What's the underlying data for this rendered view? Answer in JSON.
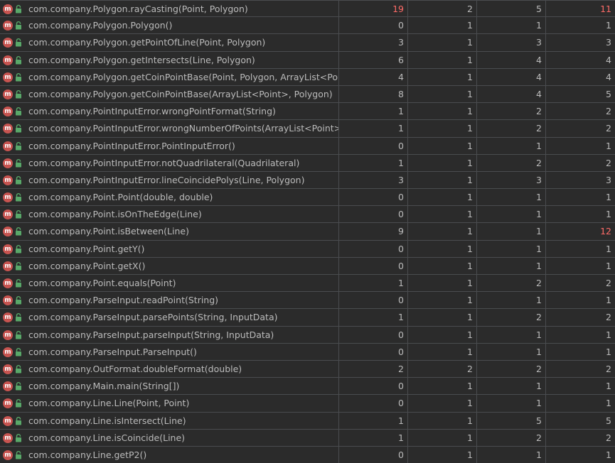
{
  "colors": {
    "background": "#2b2b2b",
    "grid": "#4a4c4f",
    "text": "#bbbbbb",
    "highlight": "#ff6b68",
    "method_icon": "#c75450",
    "access_icon": "#59a869"
  },
  "icons": {
    "method": "method-m-icon",
    "access": "public-lock-icon",
    "method_letter": "m"
  },
  "rows": [
    {
      "method": "com.company.Polygon.rayCasting(Point, Polygon)",
      "v1": "19",
      "v2": "2",
      "v3": "5",
      "v4": "11",
      "hot1": true,
      "hot4": true
    },
    {
      "method": "com.company.Polygon.Polygon()",
      "v1": "0",
      "v2": "1",
      "v3": "1",
      "v4": "1"
    },
    {
      "method": "com.company.Polygon.getPointOfLine(Point, Polygon)",
      "v1": "3",
      "v2": "1",
      "v3": "3",
      "v4": "3"
    },
    {
      "method": "com.company.Polygon.getIntersects(Line, Polygon)",
      "v1": "6",
      "v2": "1",
      "v3": "4",
      "v4": "4"
    },
    {
      "method": "com.company.Polygon.getCoinPointBase(Point, Polygon, ArrayList<Point>)",
      "v1": "4",
      "v2": "1",
      "v3": "4",
      "v4": "4"
    },
    {
      "method": "com.company.Polygon.getCoinPointBase(ArrayList<Point>, Polygon)",
      "v1": "8",
      "v2": "1",
      "v3": "4",
      "v4": "5"
    },
    {
      "method": "com.company.PointInputError.wrongPointFormat(String)",
      "v1": "1",
      "v2": "1",
      "v3": "2",
      "v4": "2"
    },
    {
      "method": "com.company.PointInputError.wrongNumberOfPoints(ArrayList<Point>, int)",
      "v1": "1",
      "v2": "1",
      "v3": "2",
      "v4": "2"
    },
    {
      "method": "com.company.PointInputError.PointInputError()",
      "v1": "0",
      "v2": "1",
      "v3": "1",
      "v4": "1"
    },
    {
      "method": "com.company.PointInputError.notQuadrilateral(Quadrilateral)",
      "v1": "1",
      "v2": "1",
      "v3": "2",
      "v4": "2"
    },
    {
      "method": "com.company.PointInputError.lineCoincidePolys(Line, Polygon)",
      "v1": "3",
      "v2": "1",
      "v3": "3",
      "v4": "3"
    },
    {
      "method": "com.company.Point.Point(double, double)",
      "v1": "0",
      "v2": "1",
      "v3": "1",
      "v4": "1"
    },
    {
      "method": "com.company.Point.isOnTheEdge(Line)",
      "v1": "0",
      "v2": "1",
      "v3": "1",
      "v4": "1"
    },
    {
      "method": "com.company.Point.isBetween(Line)",
      "v1": "9",
      "v2": "1",
      "v3": "1",
      "v4": "12",
      "hot4": true
    },
    {
      "method": "com.company.Point.getY()",
      "v1": "0",
      "v2": "1",
      "v3": "1",
      "v4": "1"
    },
    {
      "method": "com.company.Point.getX()",
      "v1": "0",
      "v2": "1",
      "v3": "1",
      "v4": "1"
    },
    {
      "method": "com.company.Point.equals(Point)",
      "v1": "1",
      "v2": "1",
      "v3": "2",
      "v4": "2"
    },
    {
      "method": "com.company.ParseInput.readPoint(String)",
      "v1": "0",
      "v2": "1",
      "v3": "1",
      "v4": "1"
    },
    {
      "method": "com.company.ParseInput.parsePoints(String, InputData)",
      "v1": "1",
      "v2": "1",
      "v3": "2",
      "v4": "2"
    },
    {
      "method": "com.company.ParseInput.parseInput(String, InputData)",
      "v1": "0",
      "v2": "1",
      "v3": "1",
      "v4": "1"
    },
    {
      "method": "com.company.ParseInput.ParseInput()",
      "v1": "0",
      "v2": "1",
      "v3": "1",
      "v4": "1"
    },
    {
      "method": "com.company.OutFormat.doubleFormat(double)",
      "v1": "2",
      "v2": "2",
      "v3": "2",
      "v4": "2"
    },
    {
      "method": "com.company.Main.main(String[])",
      "v1": "0",
      "v2": "1",
      "v3": "1",
      "v4": "1"
    },
    {
      "method": "com.company.Line.Line(Point, Point)",
      "v1": "0",
      "v2": "1",
      "v3": "1",
      "v4": "1"
    },
    {
      "method": "com.company.Line.isIntersect(Line)",
      "v1": "1",
      "v2": "1",
      "v3": "5",
      "v4": "5"
    },
    {
      "method": "com.company.Line.isCoincide(Line)",
      "v1": "1",
      "v2": "1",
      "v3": "2",
      "v4": "2"
    },
    {
      "method": "com.company.Line.getP2()",
      "v1": "0",
      "v2": "1",
      "v3": "1",
      "v4": "1"
    }
  ]
}
